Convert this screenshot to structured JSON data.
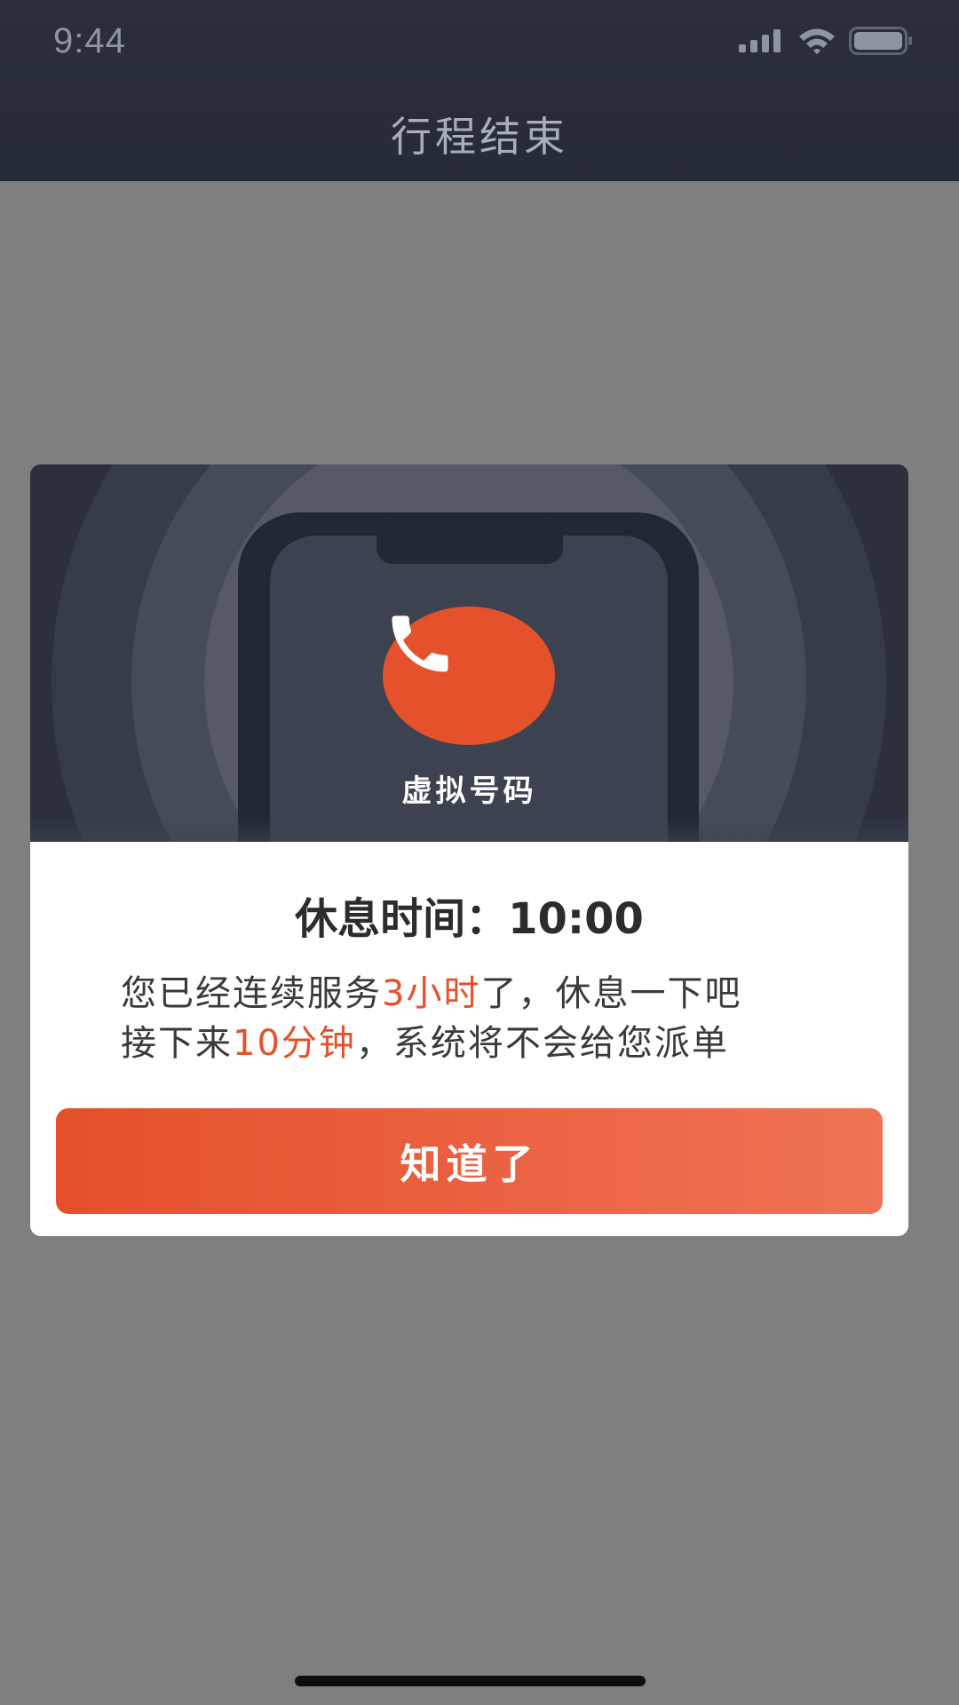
{
  "status_bar": {
    "time": "9:44",
    "icons": [
      "signal-icon",
      "wifi-icon",
      "battery-icon"
    ]
  },
  "header": {
    "title": "行程结束"
  },
  "dialog": {
    "hero_label": "虚拟号码",
    "hero_icon": "phone-icon",
    "rest_time": "休息时间：10:00",
    "message": {
      "line1_prefix": "您已经连续服务",
      "line1_highlight": "3小时",
      "line1_suffix": "了，休息一下吧",
      "line2_prefix": "接下来",
      "line2_highlight": "10分钟",
      "line2_suffix": "，系统将不会给您派单"
    },
    "confirm_label": "知道了"
  },
  "colors": {
    "accent": "#e5512b",
    "header_bg": "#272c38",
    "overlay": "#7f7f7f"
  }
}
